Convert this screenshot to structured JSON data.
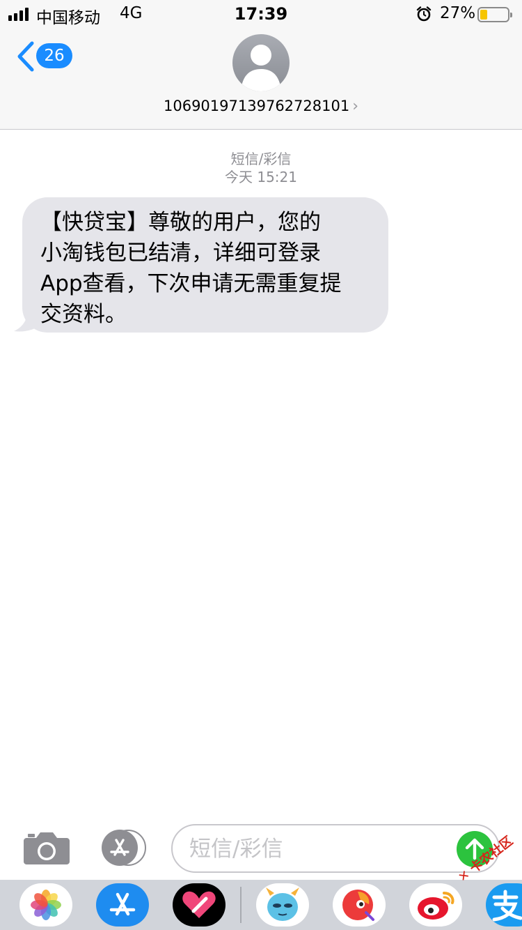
{
  "status_bar": {
    "carrier": "中国移动",
    "network": "4G",
    "time": "17:39",
    "battery_percent": "27%",
    "battery_level": 0.27,
    "signal_bars": 4
  },
  "header": {
    "back_count": "26",
    "contact_number": "10690197139762728101",
    "contact_chevron": "›"
  },
  "conversation": {
    "message_type": "短信/彩信",
    "timestamp": "今天 15:21",
    "messages": [
      {
        "direction": "incoming",
        "lines": [
          "【快贷宝】尊敬的用户，您的",
          "小淘钱包已结清，详细可登录",
          "App查看，下次申请无需重复提",
          "交资料。"
        ]
      }
    ]
  },
  "input_bar": {
    "placeholder": "短信/彩信",
    "value": ""
  },
  "app_tray": {
    "apps": [
      "photos-icon",
      "app-store-icon",
      "heart-app-icon",
      "cartoon-monster-app-icon",
      "red-bird-app-icon",
      "weibo-icon",
      "alipay-icon"
    ]
  },
  "watermark": "卡农社区",
  "colors": {
    "accent_blue": "#1a8cff",
    "bubble_gray": "#e5e5ea",
    "send_green": "#2cc33e",
    "battery_yellow": "#f6c500"
  }
}
